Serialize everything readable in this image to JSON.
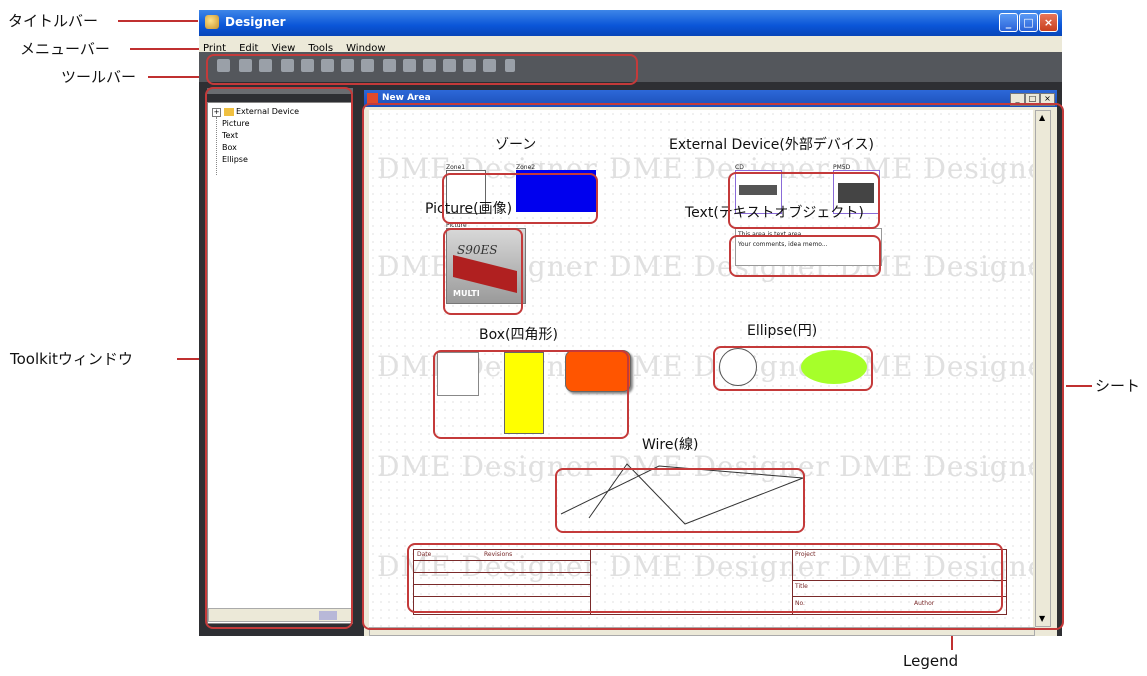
{
  "window": {
    "title": "Designer",
    "controls": [
      "_",
      "□",
      "×"
    ]
  },
  "menu": {
    "items": [
      "Print",
      "Edit",
      "View",
      "Tools",
      "Window"
    ]
  },
  "annotations": {
    "titlebar": "タイトルバー",
    "menubar": "メニューバー",
    "toolbar": "ツールバー",
    "toolkit": "Toolkitウィンドウ",
    "sheet": "シート",
    "legend": "Legend"
  },
  "toolkit": {
    "items": [
      "External Device",
      "Picture",
      "Text",
      "Box",
      "Ellipse"
    ]
  },
  "sheet": {
    "title": "New Area",
    "watermark": "DME Designer",
    "labels": {
      "zone": "ゾーン",
      "external": "External Device(外部デバイス)",
      "picture": "Picture(画像)",
      "text": "Text(テキストオブジェクト)",
      "box": "Box(四角形)",
      "ellipse": "Ellipse(円)",
      "wire": "Wire(線)"
    },
    "zone": {
      "z1": "Zone1",
      "z2": "Zone2"
    },
    "external": {
      "d1": "CD",
      "d2": "PM5D"
    },
    "picture": {
      "caption": "Picture",
      "brand": "S90ES",
      "sub": "MULTI"
    },
    "text_object": {
      "line1": "This area is text area.",
      "line2": "Your comments, idea memo..."
    },
    "legend": {
      "date": "Date",
      "revisions": "Revisions",
      "project": "Project",
      "title": "Title",
      "no": "No.",
      "author": "Author"
    }
  },
  "colors": {
    "callout": "#c43a3a",
    "zone2": "#0000ee",
    "yellow": "#ffff00",
    "orange": "#ff5500",
    "green": "#a6ff2a"
  }
}
